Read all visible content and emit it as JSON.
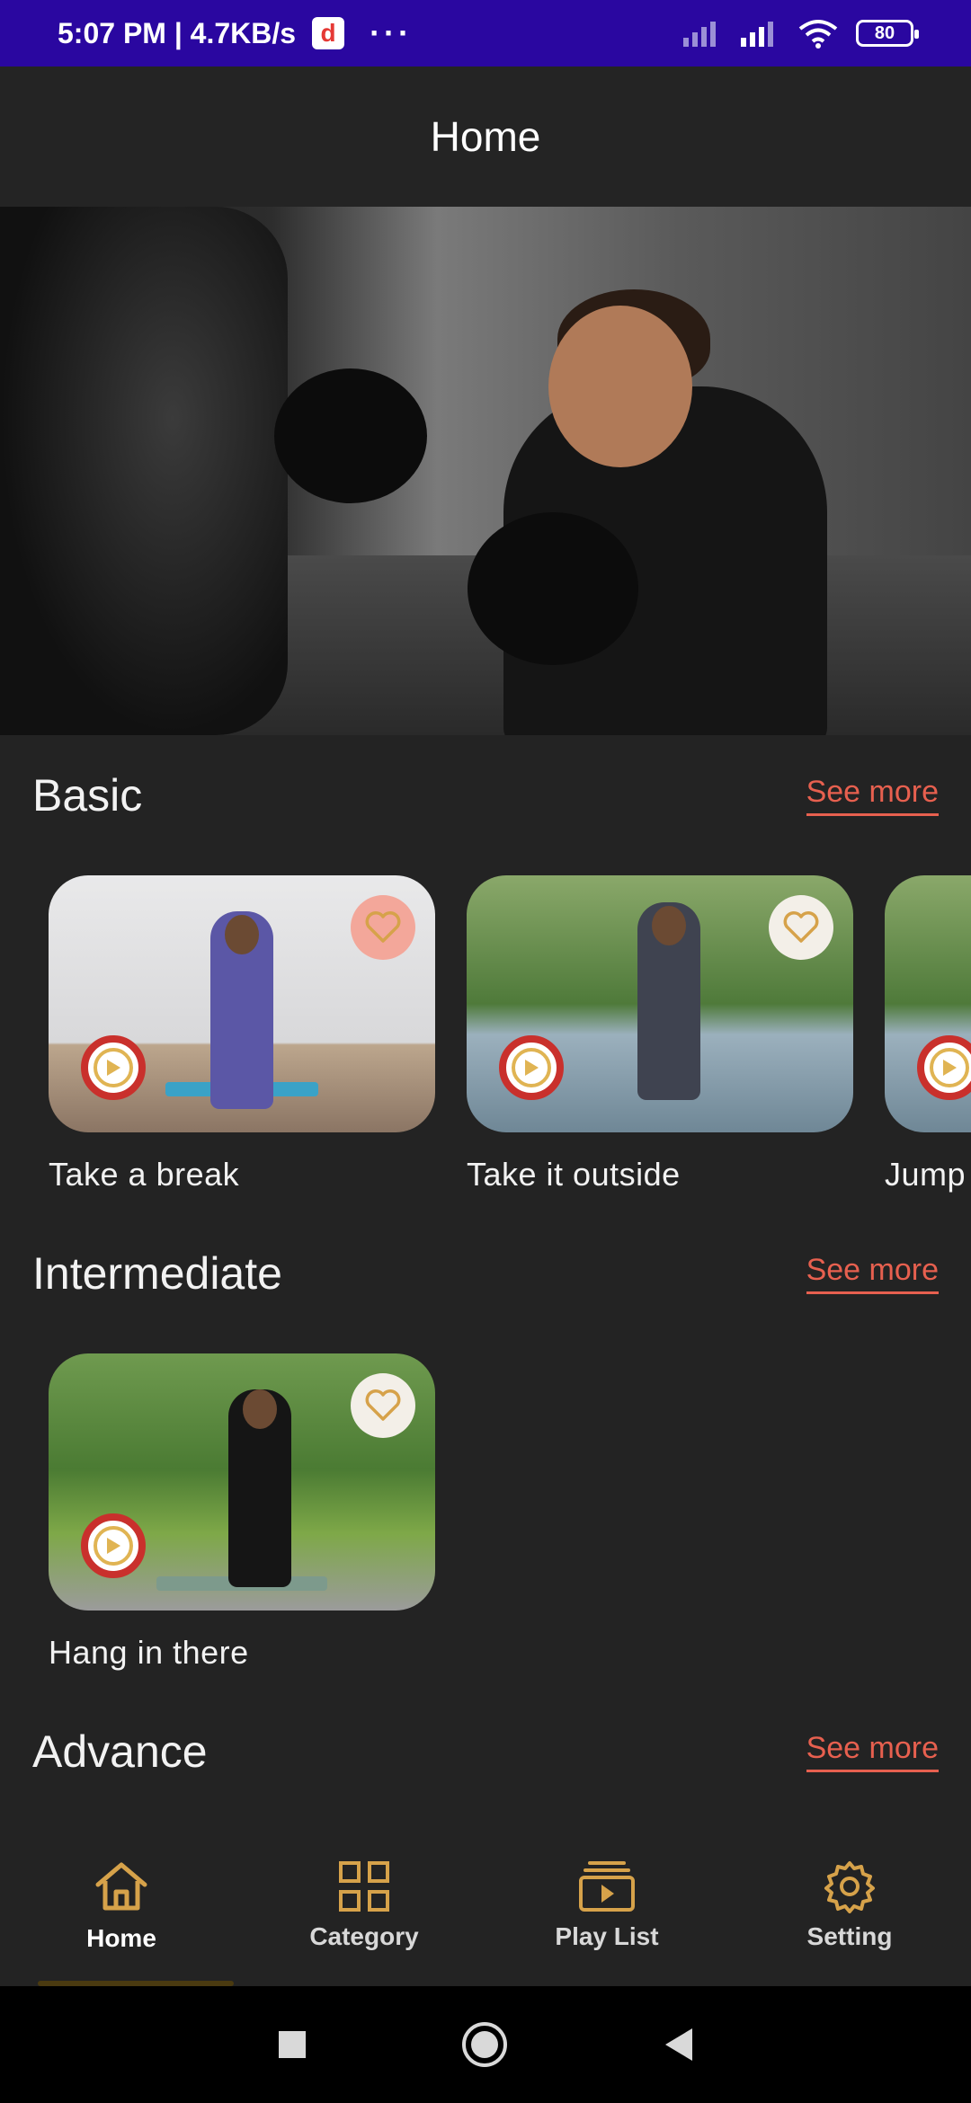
{
  "status_bar": {
    "time_speed": "5:07 PM | 4.7KB/s",
    "app_icon_letter": "d",
    "dots": "···",
    "battery": "80"
  },
  "app_bar": {
    "title": "Home"
  },
  "sections": [
    {
      "title": "Basic",
      "see_more": "See more",
      "cards": [
        {
          "title": "Take a break",
          "favorited": true
        },
        {
          "title": "Take it outside",
          "favorited": false
        },
        {
          "title": "Jump",
          "favorited": false
        }
      ]
    },
    {
      "title": "Intermediate",
      "see_more": "See more",
      "cards": [
        {
          "title": "Hang in there",
          "favorited": false
        }
      ]
    },
    {
      "title": "Advance",
      "see_more": "See more",
      "cards": []
    }
  ],
  "bottom_nav": [
    {
      "label": "Home",
      "icon": "home-icon",
      "active": true
    },
    {
      "label": "Category",
      "icon": "grid-icon",
      "active": false
    },
    {
      "label": "Play List",
      "icon": "playlist-icon",
      "active": false
    },
    {
      "label": "Setting",
      "icon": "gear-icon",
      "active": false
    }
  ],
  "colors": {
    "accent": "#e7604f",
    "icon_gold": "#d6a24a",
    "background": "#232323",
    "status_bar": "#2a07a0"
  }
}
